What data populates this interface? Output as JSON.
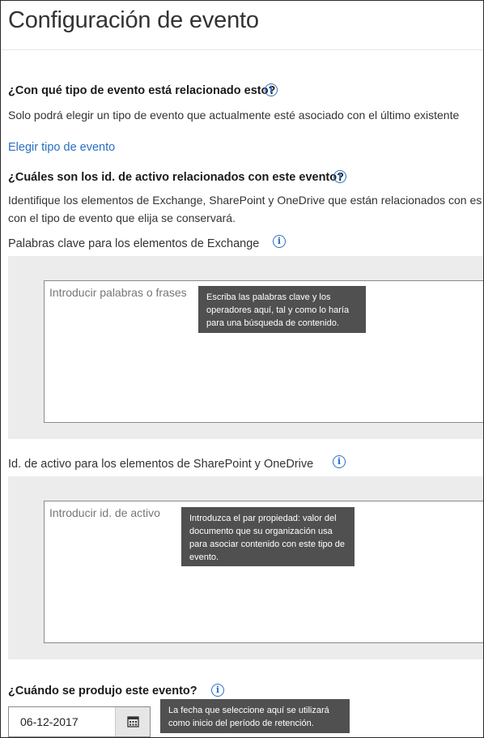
{
  "page": {
    "title": "Configuración de evento"
  },
  "event_type": {
    "question": "¿Con qué tipo de evento está relacionado esto?",
    "description": "Solo podrá elegir un tipo de evento que actualmente esté asociado con el último existente",
    "link": "Elegir tipo de evento"
  },
  "asset_ids": {
    "question": "¿Cuáles son los id. de activo relacionados con este evento?",
    "description_line1": "Identifique los elementos de Exchange, SharePoint y OneDrive que están relacionados con es",
    "description_line2": "con el tipo de evento que elija se conservará.",
    "exchange": {
      "label": "Palabras clave para los elementos de Exchange",
      "placeholder": "Introducir palabras o frases",
      "tooltip": "Escriba las palabras clave y los operadores aquí, tal y como lo haría para una búsqueda de contenido."
    },
    "sharepoint": {
      "label": "Id. de activo para los elementos de SharePoint y OneDrive",
      "placeholder": "Introducir id. de activo",
      "tooltip": "Introduzca el par propiedad: valor del documento que su organización usa para asociar contenido con este tipo de evento."
    }
  },
  "event_date": {
    "question": "¿Cuándo se produjo este evento?",
    "value": "06-12-2017",
    "tooltip": "La fecha que seleccione aquí se utilizará como inicio del período de retención."
  },
  "icons": {
    "info": "info-icon",
    "calendar": "calendar-icon"
  },
  "colors": {
    "link": "#2b6fc2",
    "tooltip_bg": "#505050",
    "panel_bg": "#ececec"
  }
}
